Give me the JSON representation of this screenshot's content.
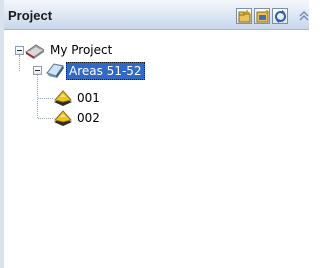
{
  "panel": {
    "title": "Project",
    "toolbar": [
      {
        "name": "add-folder-icon"
      },
      {
        "name": "add-item-icon"
      },
      {
        "name": "refresh-icon"
      }
    ],
    "collapse_icon": "double-chevron-up-icon"
  },
  "tree": {
    "root": {
      "label": "My Project",
      "icon": "project-book-icon",
      "expanded": true
    },
    "group": {
      "label": "Areas 51-52",
      "icon": "area-folder-icon",
      "expanded": true,
      "selected": true
    },
    "items": [
      {
        "label": "001",
        "icon": "area-layer-icon"
      },
      {
        "label": "002",
        "icon": "area-layer-icon"
      }
    ]
  },
  "colors": {
    "selection": "#3169c6",
    "titlebar": "#dce6f3"
  }
}
